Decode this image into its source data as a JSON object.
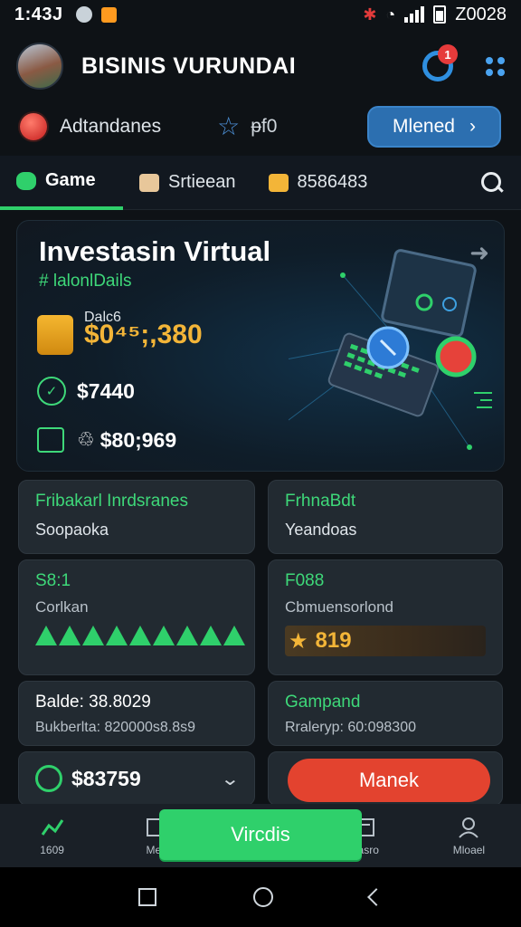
{
  "status_bar": {
    "time": "1:43J",
    "battery_text": "Z0028"
  },
  "header": {
    "title": "BISINIS VURUNDAI",
    "notification_count": "1"
  },
  "sub_row": {
    "label": "Adtandanes",
    "star_value": "ᵽf0",
    "primary_button": "Mlened"
  },
  "tabs": [
    {
      "label": "Game",
      "icon": "game-icon",
      "color": "#2fd06b"
    },
    {
      "label": "Srtieean",
      "icon": "shop-icon",
      "color": "#e8c79a"
    },
    {
      "label": "8586483",
      "icon": "coin-icon",
      "color": "#f3b538"
    }
  ],
  "hero": {
    "title": "Investasin Virtual",
    "subtitle": "#  lalonlDails",
    "small_label": "Dalc6",
    "big_value": "$0⁴⁵;,380",
    "row1_value": "$7440",
    "row2_value": "$80;969"
  },
  "cards": {
    "c1": {
      "title": "Fribakarl Inrdsranes",
      "text": "Soopaoka"
    },
    "c2": {
      "title": "FrhnaBdt",
      "text": "Yeandoas"
    },
    "c3": {
      "title": "S8:1",
      "text": "Corlkan",
      "fill_triangles": 9
    },
    "c4": {
      "title": "F088",
      "text": "Cbmuensorlond",
      "rating": "819"
    },
    "c5": {
      "title": "Balde: 38.8029",
      "text": "Bukberlta: 820000s8.8s9"
    },
    "c6": {
      "title": "Gampand",
      "text": "Rraleryp: 60:098300"
    },
    "c7": {
      "value": "$83759"
    }
  },
  "red_button": "Manek",
  "cta_button": "Vircdis",
  "bottom_nav": [
    {
      "label": "1609",
      "icon": "chart-icon"
    },
    {
      "label": "Mes",
      "icon": "book-icon"
    },
    {
      "label": "Aasro",
      "icon": "calendar-icon"
    },
    {
      "label": "Mloael",
      "icon": "person-icon"
    }
  ],
  "colors": {
    "accent_green": "#2fd06b",
    "accent_blue": "#2c6fb0",
    "accent_gold": "#f3b538",
    "accent_red": "#e3432f"
  }
}
